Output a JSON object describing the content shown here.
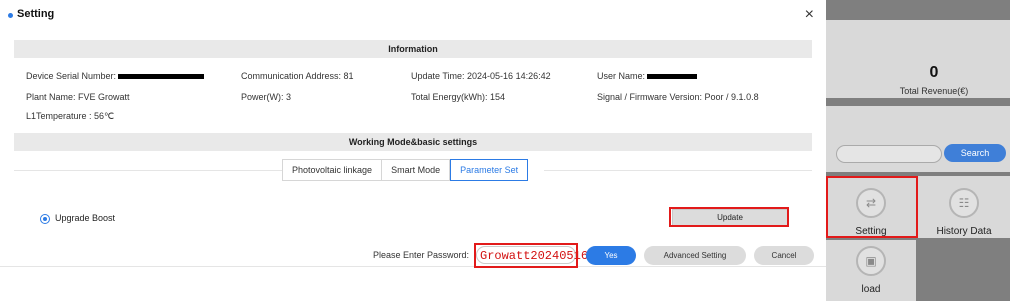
{
  "dialog": {
    "title": "Setting",
    "close_glyph": "×"
  },
  "information": {
    "header": "Information",
    "device_serial_label": "Device Serial Number:",
    "communication_address": "Communication Address:  81",
    "update_time": "Update Time:  2024-05-16 14:26:42",
    "user_name_label": "User Name:",
    "plant_name": "Plant Name:  FVE Growatt",
    "power": "Power(W):  3",
    "total_energy": "Total Energy(kWh):  154",
    "signal_firmware": "Signal / Firmware Version:   Poor / 9.1.0.8",
    "l1_temperature": "L1Temperature : 56℃"
  },
  "working_mode": {
    "header": "Working Mode&basic settings",
    "tabs": [
      {
        "label": "Photovoltaic linkage",
        "active": false
      },
      {
        "label": "Smart Mode",
        "active": false
      },
      {
        "label": "Parameter Set",
        "active": true
      }
    ],
    "radio_label": "Upgrade Boost",
    "update_button": "Update"
  },
  "footer": {
    "password_label": "Please Enter Password:",
    "password_value": "Growatt20240516",
    "yes_button": "Yes",
    "advanced_button": "Advanced Setting",
    "cancel_button": "Cancel"
  },
  "background": {
    "revenue_value": "0",
    "revenue_label": "Total Revenue(€)",
    "search_button": "Search",
    "tiles": [
      {
        "label": "Setting",
        "icon": "sliders-icon"
      },
      {
        "label": "History Data",
        "icon": "grid-icon"
      },
      {
        "label": "load",
        "icon": "load-icon"
      }
    ]
  },
  "colors": {
    "accent": "#2c7be5",
    "highlight": "#e21a1a"
  }
}
